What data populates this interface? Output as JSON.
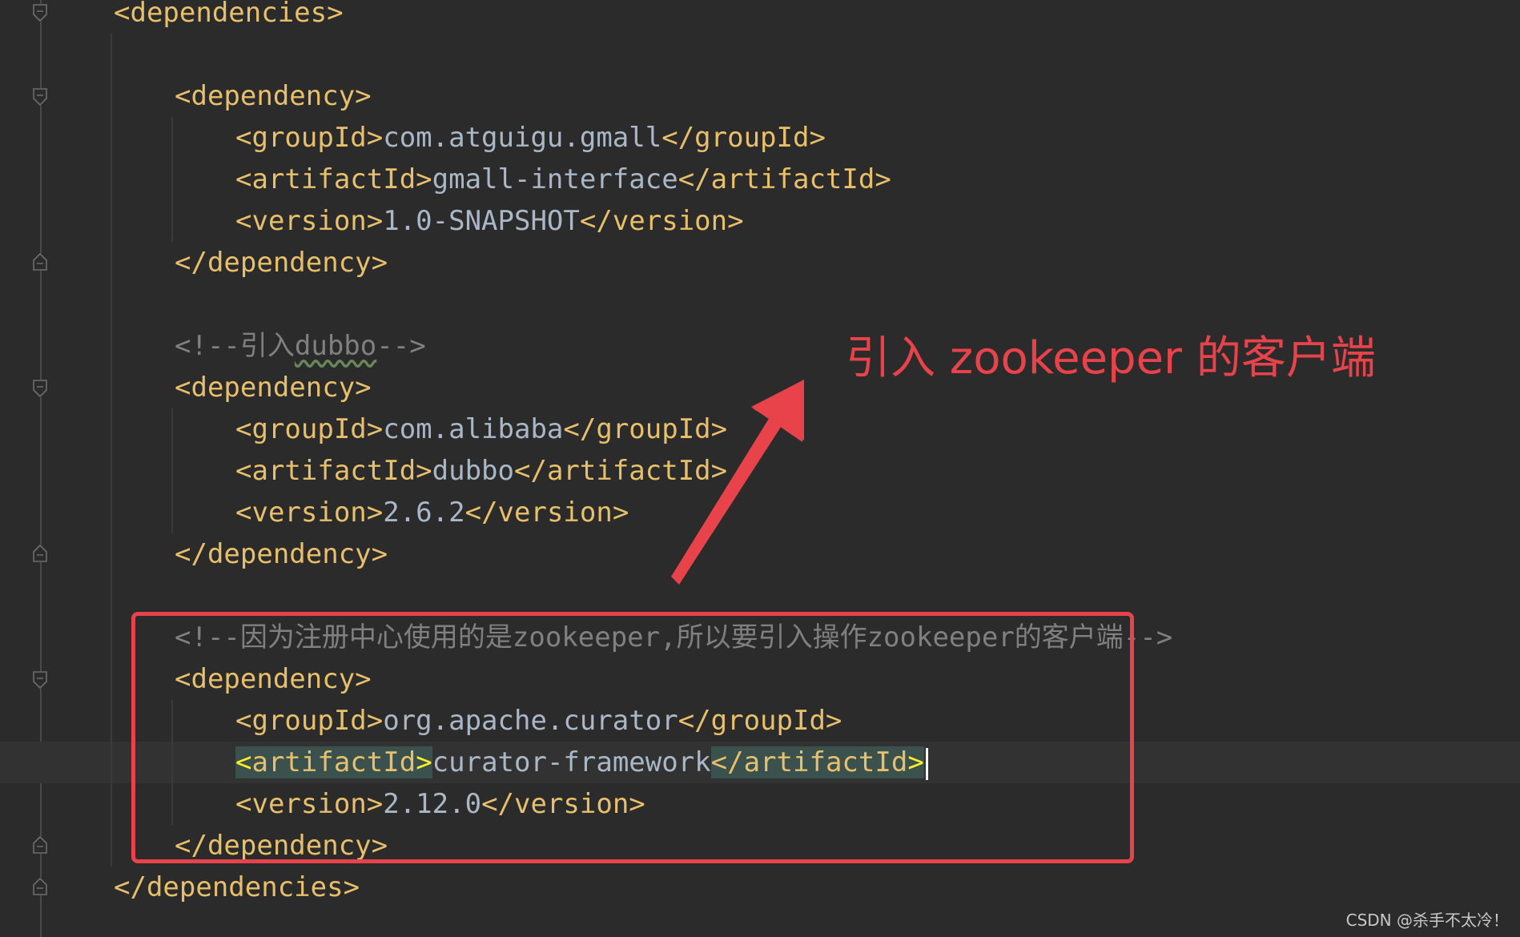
{
  "editor": {
    "lines": [
      {
        "id": "l1",
        "parts": [
          [
            "tag",
            "<dependencies>"
          ]
        ]
      },
      {
        "id": "l3",
        "parts": [
          [
            "tag",
            "<dependency>"
          ]
        ]
      },
      {
        "id": "l4",
        "parts": [
          [
            "tag",
            "<groupId>"
          ],
          [
            "txt",
            "com.atguigu.gmall"
          ],
          [
            "tag",
            "</groupId>"
          ]
        ]
      },
      {
        "id": "l5",
        "parts": [
          [
            "tag",
            "<artifactId>"
          ],
          [
            "txt",
            "gmall-interface"
          ],
          [
            "tag",
            "</artifactId>"
          ]
        ]
      },
      {
        "id": "l6",
        "parts": [
          [
            "tag",
            "<version>"
          ],
          [
            "txt",
            "1.0-SNAPSHOT"
          ],
          [
            "tag",
            "</version>"
          ]
        ]
      },
      {
        "id": "l7",
        "parts": [
          [
            "tag",
            "</dependency>"
          ]
        ]
      },
      {
        "id": "l9",
        "parts": [
          [
            "cmt",
            "<!--引入"
          ],
          [
            "cmtw",
            "dubbo"
          ],
          [
            "cmt",
            "-->"
          ]
        ]
      },
      {
        "id": "l10",
        "parts": [
          [
            "tag",
            "<dependency>"
          ]
        ]
      },
      {
        "id": "l11",
        "parts": [
          [
            "tag",
            "<groupId>"
          ],
          [
            "txt",
            "com.alibaba"
          ],
          [
            "tag",
            "</groupId>"
          ]
        ]
      },
      {
        "id": "l12",
        "parts": [
          [
            "tag",
            "<artifactId>"
          ],
          [
            "txt",
            "dubbo"
          ],
          [
            "tag",
            "</artifactId>"
          ]
        ]
      },
      {
        "id": "l13",
        "parts": [
          [
            "tag",
            "<version>"
          ],
          [
            "txt",
            "2.6.2"
          ],
          [
            "tag",
            "</version>"
          ]
        ]
      },
      {
        "id": "l14",
        "parts": [
          [
            "tag",
            "</dependency>"
          ]
        ]
      },
      {
        "id": "l16",
        "parts": [
          [
            "cmt",
            "<!--因为注册中心使用的是zookeeper,所以要引入操作zookeeper的客户端-->"
          ]
        ]
      },
      {
        "id": "l17",
        "parts": [
          [
            "tag",
            "<dependency>"
          ]
        ]
      },
      {
        "id": "l18",
        "parts": [
          [
            "tag",
            "<groupId>"
          ],
          [
            "txt",
            "org.apache.curator"
          ],
          [
            "tag",
            "</groupId>"
          ]
        ]
      },
      {
        "id": "l19",
        "parts": [
          [
            "match",
            "<artifactId>"
          ],
          [
            "txt",
            "curator-framework"
          ],
          [
            "match",
            "</artifactId>"
          ]
        ]
      },
      {
        "id": "l20",
        "parts": [
          [
            "tag",
            "<version>"
          ],
          [
            "txt",
            "2.12.0"
          ],
          [
            "tag",
            "</version>"
          ]
        ]
      },
      {
        "id": "l21",
        "parts": [
          [
            "tag",
            "</dependency>"
          ]
        ]
      },
      {
        "id": "l22",
        "parts": [
          [
            "tag",
            "</dependencies>"
          ]
        ]
      }
    ]
  },
  "annotation": {
    "text": "引入 zookeeper 的客户端"
  },
  "watermark": {
    "text": "CSDN @杀手不太冷！"
  },
  "colors": {
    "background": "#2b2b2b",
    "tag": "#e8bf6a",
    "text": "#a9b7c6",
    "comment": "#808080",
    "annotation_red": "#e8424a"
  }
}
